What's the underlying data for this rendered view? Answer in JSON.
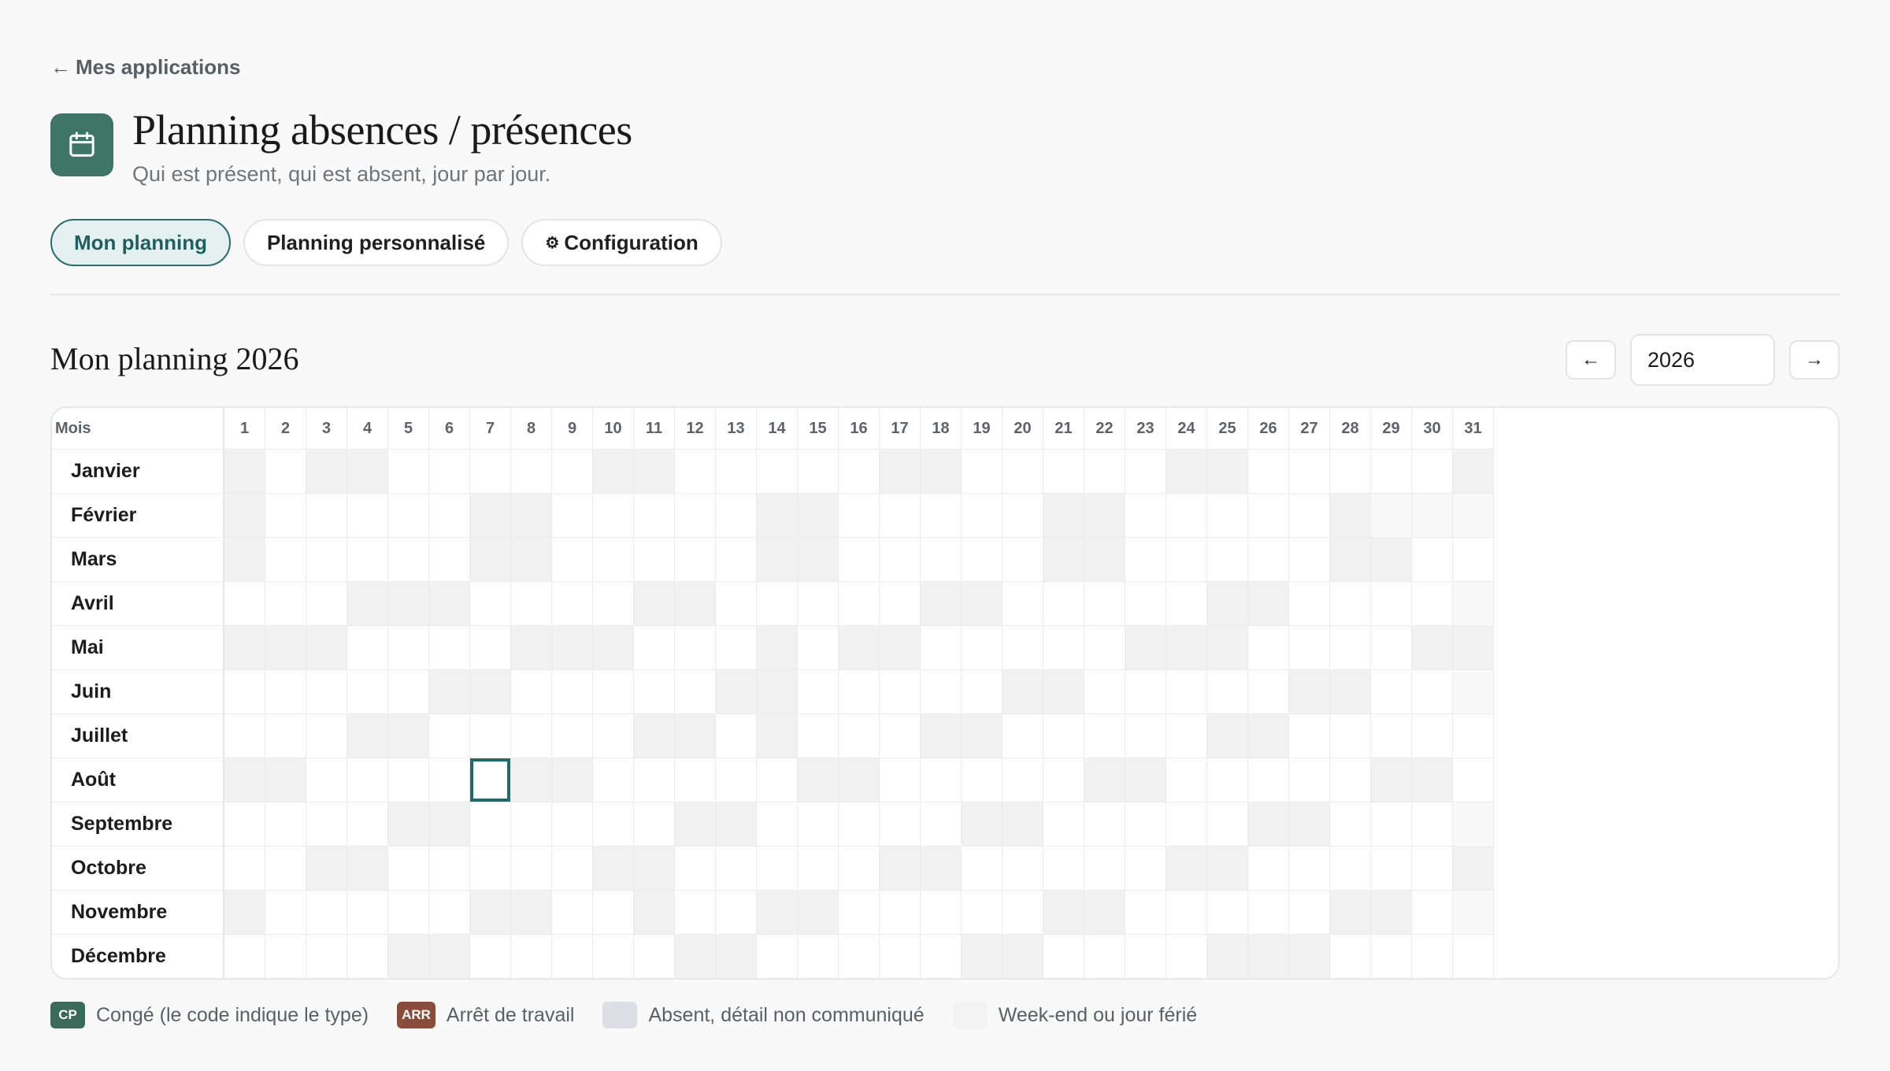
{
  "nav": {
    "back_label": "Mes applications",
    "back_icon": "arrow-left-icon"
  },
  "app": {
    "icon": "calendar-icon",
    "icon_bg": "#3e7565",
    "title": "Planning absences / présences",
    "subtitle": "Qui est présent, qui est absent, jour par jour."
  },
  "tabs": [
    {
      "label": "Mon planning",
      "active": true
    },
    {
      "label": "Planning personnalisé",
      "active": false
    },
    {
      "label": "Configuration",
      "active": false,
      "icon": "gear-icon"
    }
  ],
  "planning": {
    "section_title": "Mon planning 2026",
    "year_value": "2026",
    "prev_year_icon": "arrow-left-icon",
    "next_year_icon": "arrow-right-icon",
    "grid": {
      "month_header": "Mois",
      "days": [
        "1",
        "2",
        "3",
        "4",
        "5",
        "6",
        "7",
        "8",
        "9",
        "10",
        "11",
        "12",
        "13",
        "14",
        "15",
        "16",
        "17",
        "18",
        "19",
        "20",
        "21",
        "22",
        "23",
        "24",
        "25",
        "26",
        "27",
        "28",
        "29",
        "30",
        "31"
      ],
      "months": [
        {
          "name": "Janvier",
          "days_in_month": 31,
          "weekends": [
            1,
            3,
            4,
            10,
            11,
            17,
            18,
            24,
            25,
            31
          ],
          "holidays": []
        },
        {
          "name": "Février",
          "days_in_month": 28,
          "weekends": [
            1,
            7,
            8,
            14,
            15,
            21,
            22,
            28
          ],
          "holidays": []
        },
        {
          "name": "Mars",
          "days_in_month": 31,
          "weekends": [
            1,
            7,
            8,
            14,
            15,
            21,
            22,
            28,
            29
          ],
          "holidays": []
        },
        {
          "name": "Avril",
          "days_in_month": 30,
          "weekends": [
            4,
            5,
            6,
            11,
            12,
            18,
            19,
            25,
            26
          ],
          "holidays": []
        },
        {
          "name": "Mai",
          "days_in_month": 31,
          "weekends": [
            1,
            2,
            3,
            8,
            9,
            10,
            14,
            16,
            17,
            23,
            24,
            25,
            30,
            31
          ],
          "holidays": []
        },
        {
          "name": "Juin",
          "days_in_month": 30,
          "weekends": [
            6,
            7,
            13,
            14,
            20,
            21,
            27,
            28
          ],
          "holidays": []
        },
        {
          "name": "Juillet",
          "days_in_month": 31,
          "weekends": [
            4,
            5,
            11,
            12,
            14,
            18,
            19,
            25,
            26
          ],
          "holidays": []
        },
        {
          "name": "Août",
          "days_in_month": 31,
          "weekends": [
            1,
            2,
            8,
            9,
            15,
            16,
            22,
            23,
            29,
            30
          ],
          "holidays": []
        },
        {
          "name": "Septembre",
          "days_in_month": 30,
          "weekends": [
            5,
            6,
            12,
            13,
            19,
            20,
            26,
            27
          ],
          "holidays": []
        },
        {
          "name": "Octobre",
          "days_in_month": 31,
          "weekends": [
            3,
            4,
            10,
            11,
            17,
            18,
            24,
            25,
            31
          ],
          "holidays": []
        },
        {
          "name": "Novembre",
          "days_in_month": 30,
          "weekends": [
            1,
            7,
            8,
            11,
            14,
            15,
            21,
            22,
            28,
            29
          ],
          "holidays": []
        },
        {
          "name": "Décembre",
          "days_in_month": 31,
          "weekends": [
            5,
            6,
            12,
            13,
            19,
            20,
            25,
            26,
            27
          ],
          "holidays": []
        }
      ],
      "selected": {
        "month": "Août",
        "day": 7
      }
    }
  },
  "legend": [
    {
      "kind": "badge",
      "code": "CP",
      "color": "#3a6b5a",
      "label": "Congé (le code indique le type)"
    },
    {
      "kind": "badge",
      "code": "ARR",
      "color": "#8b4d3b",
      "label": "Arrêt de travail"
    },
    {
      "kind": "swatch",
      "color": "#dcdfe3",
      "label": "Absent, détail non communiqué"
    },
    {
      "kind": "swatch",
      "color": "#f3f3f4",
      "label": "Week-end ou jour férié"
    }
  ],
  "colors": {
    "accent": "#1f6b6b",
    "weekend_cell": "#f1f1f2",
    "non_day_cell": "#f9f9f9"
  }
}
